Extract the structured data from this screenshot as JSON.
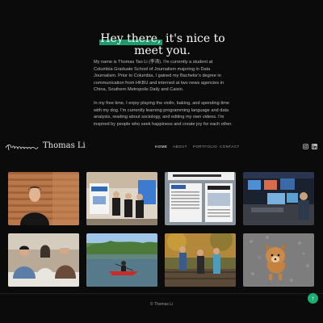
{
  "hero": {
    "headline_highlight": "Hey there,",
    "headline_rest": " it's nice to meet you.",
    "paragraph1": "My name is Thomas Tao Li (李涛). I'm currently a student at Columbia Graduate School of Journalism majoring in Data Journalism. Prior to Columbia, I gained my Bachelor's degree in communication from HKBU and interned at two news agencies in China, Southern Metropolis Daily and Caixin.",
    "paragraph2": "In my free time, I enjoy playing the violin, baking, and spending time with my dog. I'm currently learning programming language and data analysis, reading about sociology, and editing my own videos. I'm inspired by people who seek happiness and create joy for each other.",
    "accent_color": "#1f9a6e"
  },
  "nav": {
    "logo_script": "thomas",
    "logo_name": "Thomas Li",
    "links": [
      "HOME",
      "ABOUT",
      "PORTFOLIO",
      "CONTACT"
    ],
    "active": "HOME",
    "social_icons": [
      "instagram-icon",
      "linkedin-icon"
    ]
  },
  "gallery": {
    "items": [
      {
        "name": "portrait-wood-wall"
      },
      {
        "name": "award-ceremony-group"
      },
      {
        "name": "newspaper-award-page"
      },
      {
        "name": "newsroom-studio"
      },
      {
        "name": "family-at-table"
      },
      {
        "name": "kayaking-on-lake"
      },
      {
        "name": "friends-on-trail"
      },
      {
        "name": "pet-dog"
      }
    ]
  },
  "footer": {
    "copyright": "© Thomas Li",
    "back_to_top_color": "#1fae72"
  }
}
